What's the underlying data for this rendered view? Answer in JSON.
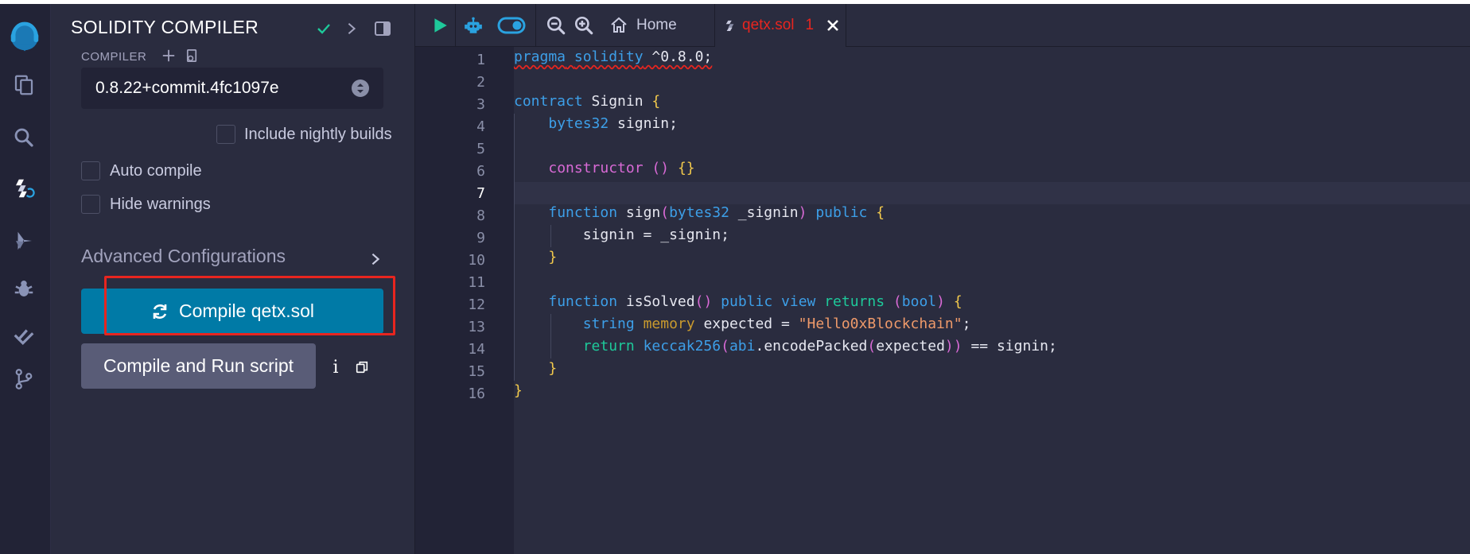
{
  "panel": {
    "title": "SOLIDITY COMPILER",
    "compiler_label": "COMPILER",
    "compiler_version": "0.8.22+commit.4fc1097e",
    "nightly_label": "Include nightly builds",
    "auto_compile_label": "Auto compile",
    "hide_warnings_label": "Hide warnings",
    "advanced_label": "Advanced Configurations",
    "compile_button": "Compile qetx.sol",
    "run_button": "Compile and Run script"
  },
  "tabs": {
    "home": "Home",
    "file": "qetx.sol",
    "file_problems": "1"
  },
  "icons": {
    "rail": [
      "remix-logo-icon",
      "file-explorer-icon",
      "search-icon",
      "solidity-compiler-icon",
      "deploy-run-icon",
      "debugger-icon",
      "test-check-icon",
      "git-icon"
    ],
    "toolbar": [
      "run-icon",
      "copilot-bot-icon",
      "toggle-icon",
      "zoom-out-icon",
      "zoom-in-icon",
      "home-icon"
    ]
  },
  "colors": {
    "compile_button": "#007aa6",
    "highlight": "#e8251f",
    "file_tab_text": "#e8251f"
  },
  "editor": {
    "current_line": 7,
    "line_numbers": [
      "1",
      "2",
      "3",
      "4",
      "5",
      "6",
      "7",
      "8",
      "9",
      "10",
      "11",
      "12",
      "13",
      "14",
      "15",
      "16"
    ],
    "lines": [
      "pragma solidity ^0.8.0;",
      "",
      "contract Signin {",
      "    bytes32 signin;",
      "",
      "    constructor () {}",
      "",
      "    function sign(bytes32 _signin) public {",
      "        signin = _signin;",
      "    }",
      "",
      "    function isSolved() public view returns (bool) {",
      "        string memory expected = \"Hello0xBlockchain\";",
      "        return keccak256(abi.encodePacked(expected)) == signin;",
      "    }",
      "}"
    ]
  }
}
